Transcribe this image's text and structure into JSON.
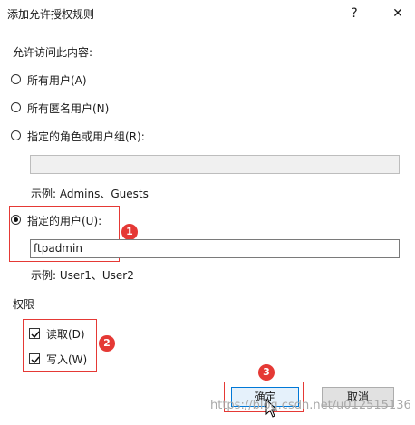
{
  "dialog": {
    "title": "添加允许授权规则",
    "help_label": "?",
    "close_label": "✕"
  },
  "access": {
    "heading": "允许访问此内容:",
    "options": [
      {
        "label": "所有用户(A)",
        "selected": false
      },
      {
        "label": "所有匿名用户(N)",
        "selected": false
      },
      {
        "label": "指定的角色或用户组(R):",
        "selected": false
      },
      {
        "label": "指定的用户(U):",
        "selected": true
      }
    ],
    "roles_value": "",
    "roles_example": "示例: Admins、Guests",
    "users_value": "ftpadmin",
    "users_example": "示例: User1、User2"
  },
  "permissions": {
    "heading": "权限",
    "read_label": "读取(D)",
    "read_checked": true,
    "write_label": "写入(W)",
    "write_checked": true
  },
  "buttons": {
    "ok_label": "确定",
    "cancel_label": "取消"
  },
  "annotations": {
    "badge1": "1",
    "badge2": "2",
    "badge3": "3",
    "accent": "#e53935"
  },
  "watermark": "https://blog.csdn.net/u012515136"
}
